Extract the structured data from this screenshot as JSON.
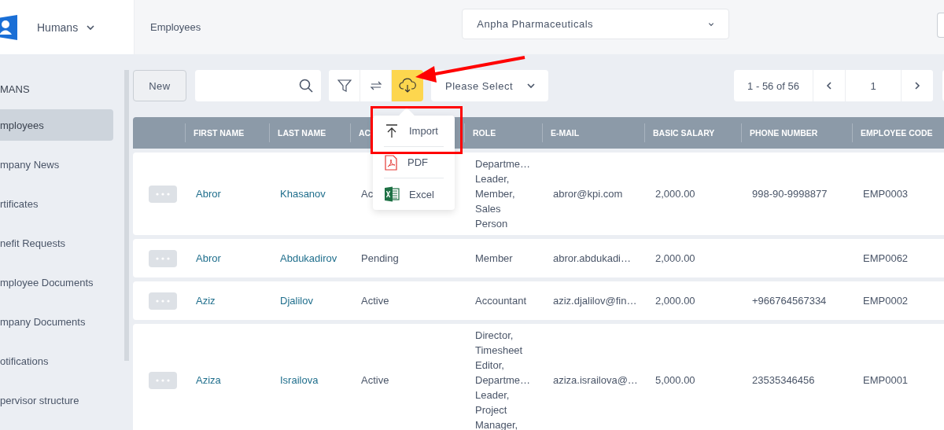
{
  "header": {
    "module": "Humans",
    "breadcrumb": "Employees",
    "company_select": {
      "value": "Anpha Pharmaceuticals"
    }
  },
  "sidebar": {
    "section": "MANS",
    "items": [
      {
        "label": "mployees",
        "selected": true
      },
      {
        "label": "mpany News",
        "selected": false
      },
      {
        "label": "rtificates",
        "selected": false
      },
      {
        "label": "nefit Requests",
        "selected": false
      },
      {
        "label": "mployee Documents",
        "selected": false
      },
      {
        "label": "mpany Documents",
        "selected": false
      },
      {
        "label": "otifications",
        "selected": false
      },
      {
        "label": "pervisor structure",
        "selected": false
      }
    ]
  },
  "toolbar": {
    "new_button": "New",
    "export_button": {
      "expanded": true
    },
    "view_select": {
      "placeholder": "Please Select"
    },
    "pagination": {
      "range": "1 - 56 of 56",
      "page": "1"
    }
  },
  "export_menu": {
    "items": [
      {
        "label": "Import",
        "kind": "import"
      },
      {
        "label": "PDF",
        "kind": "pdf"
      },
      {
        "label": "Excel",
        "kind": "excel"
      }
    ]
  },
  "table": {
    "columns": [
      "FIRST NAME",
      "LAST NAME",
      "AC",
      "ROLE",
      "E-MAIL",
      "BASIC SALARY",
      "PHONE NUMBER",
      "EMPLOYEE CODE"
    ],
    "rows": [
      {
        "first_name": "Abror",
        "last_name": "Khasanov",
        "status": "Ac",
        "role": [
          "Departme…",
          "Leader,",
          "Member,",
          "Sales",
          "Person"
        ],
        "email": "abror@kpi.com",
        "salary": "2,000.00",
        "phone": "998-90-9998877",
        "code": "EMP0003"
      },
      {
        "first_name": "Abror",
        "last_name": "Abdukadirov",
        "status": "Pending",
        "role": [
          "Member"
        ],
        "email": "abror.abdukadi…",
        "salary": "2,000.00",
        "code": "EMP0062"
      },
      {
        "first_name": "Aziz",
        "last_name": "Djalilov",
        "status": "Active",
        "role": [
          "Accountant"
        ],
        "email": "aziz.djalilov@fin…",
        "salary": "2,000.00",
        "phone": "+966764567334",
        "code": "EMP0002"
      },
      {
        "first_name": "Aziza",
        "last_name": "Israilova",
        "status": "Active",
        "role": [
          "Director,",
          "Timesheet",
          "Editor,",
          "Departme…",
          "Leader,",
          "Project",
          "Manager,"
        ],
        "email": "aziza.israilova@…",
        "salary": "5,000.00",
        "phone": "23535346456",
        "code": "EMP0001"
      }
    ]
  }
}
